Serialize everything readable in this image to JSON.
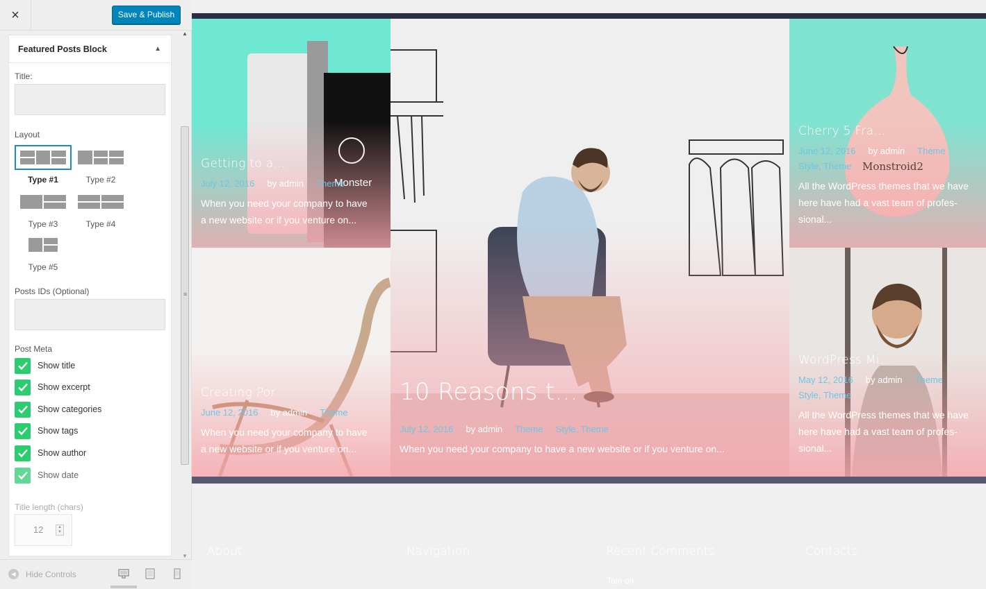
{
  "header": {
    "close_icon": "×",
    "publish_label": "Save & Publish"
  },
  "section": {
    "title": "Featured Posts Block",
    "caret": "▲"
  },
  "controls": {
    "title_label": "Title:",
    "title_value": "",
    "layout_label": "Layout",
    "layouts": [
      {
        "label": "Type #1",
        "selected": true
      },
      {
        "label": "Type #2",
        "selected": false
      },
      {
        "label": "Type #3",
        "selected": false
      },
      {
        "label": "Type #4",
        "selected": false
      },
      {
        "label": "Type #5",
        "selected": false
      }
    ],
    "post_ids_label": "Posts IDs (Optional)",
    "post_ids_value": "",
    "post_meta_label": "Post Meta",
    "post_meta": [
      {
        "label": "Show title",
        "checked": true
      },
      {
        "label": "Show excerpt",
        "checked": true
      },
      {
        "label": "Show categories",
        "checked": true
      },
      {
        "label": "Show tags",
        "checked": true
      },
      {
        "label": "Show author",
        "checked": true
      },
      {
        "label": "Show date",
        "checked": true
      }
    ],
    "title_length_label": "Title length (chars)",
    "title_length_value": "12"
  },
  "footer_controls": {
    "hide_label": "Hide Controls",
    "devices": [
      "desktop-icon",
      "tablet-icon",
      "mobile-icon"
    ]
  },
  "posts": [
    {
      "title": "Getting to a...",
      "date": "July 12, 2016",
      "author": "by admin",
      "categories": "Theme",
      "excerpt": [
        "When you need your company to have",
        "a new website or if you venture on..."
      ],
      "image": "tablet-device-image",
      "brand": "Monster"
    },
    {
      "title": "Creating Por...",
      "date": "June 12, 2016",
      "author": "by admin",
      "categories": "Theme",
      "excerpt": [
        "When you need your company to have",
        "a new website or if you venture on..."
      ],
      "image": "chair-image"
    },
    {
      "title": "10 Reasons t...",
      "date": "July 12, 2016",
      "author": "by admin",
      "categories": "Theme",
      "tags": "Style, Theme",
      "excerpt": [
        "When you need your company to have a new website or if you venture on..."
      ],
      "image": "man-in-chair-image"
    },
    {
      "title": "Cherry 5 Fra...",
      "date": "June 12, 2016",
      "author": "by admin",
      "categories": "Theme",
      "tags": "Style, Theme",
      "excerpt": [
        "All the WordPress themes that we have",
        "here have had a vast team of profes-",
        "sional..."
      ],
      "image": "drawstring-bag-image",
      "brand": "Monstroid2"
    },
    {
      "title": "WordPress Mi...",
      "date": "May 12, 2016",
      "author": "by admin",
      "categories": "Theme",
      "tags": "Style, Theme",
      "excerpt": [
        "All the WordPress themes that we have",
        "here have had a vast team of profes-",
        "sional..."
      ],
      "image": "bearded-man-image"
    }
  ],
  "site_footer": {
    "columns": [
      "About",
      "Navigation",
      "Recent Comments",
      "Contacts"
    ],
    "extra": "Tom on"
  },
  "colors": {
    "accent": "#0085ba",
    "check": "#2ecc71",
    "link": "#6cc7e6",
    "pink": "#f6a5ac",
    "mint": "#6ee8d3",
    "dark_band": "#2b2f45"
  }
}
